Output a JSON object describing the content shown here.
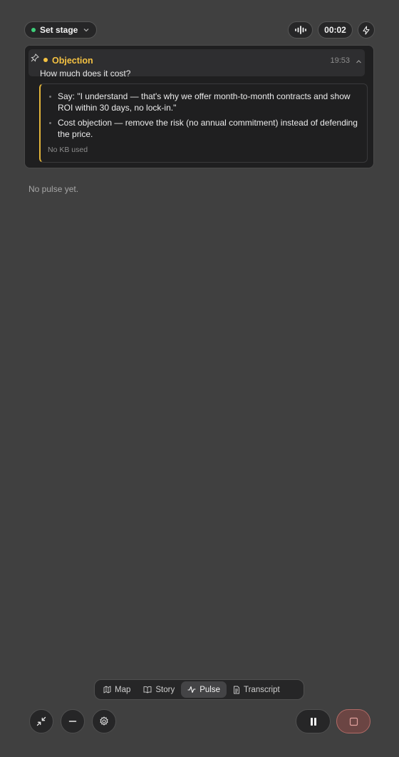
{
  "topbar": {
    "stage_label": "Set stage",
    "stage_dot_color": "#3ecf7a",
    "timer": "00:02",
    "icons": [
      "waveform-icon",
      "bolt-icon"
    ]
  },
  "card": {
    "title": "Objection",
    "accent_color": "#f5c242",
    "time": "19:53",
    "question": "How much does it cost?",
    "bullets": [
      "Say: \"I understand — that's why we offer month-to-month contracts and show ROI within 30 days, no lock-in.\"",
      "Cost objection — remove the risk (no annual commitment) instead of defending the price."
    ],
    "kb_note": "No KB used"
  },
  "pulse_empty": "No pulse yet.",
  "tabs": [
    {
      "label": "Map",
      "icon": "map-icon",
      "active": false
    },
    {
      "label": "Story",
      "icon": "book-icon",
      "active": false
    },
    {
      "label": "Pulse",
      "icon": "pulse-icon",
      "active": true
    },
    {
      "label": "Transcript",
      "icon": "document-icon",
      "active": false
    }
  ],
  "controls": {
    "left": [
      "minimize-arrows-icon",
      "minus-icon",
      "gear-icon"
    ],
    "pause": "pause-icon",
    "stop": "stop-icon",
    "stop_color": "#6b4543"
  }
}
